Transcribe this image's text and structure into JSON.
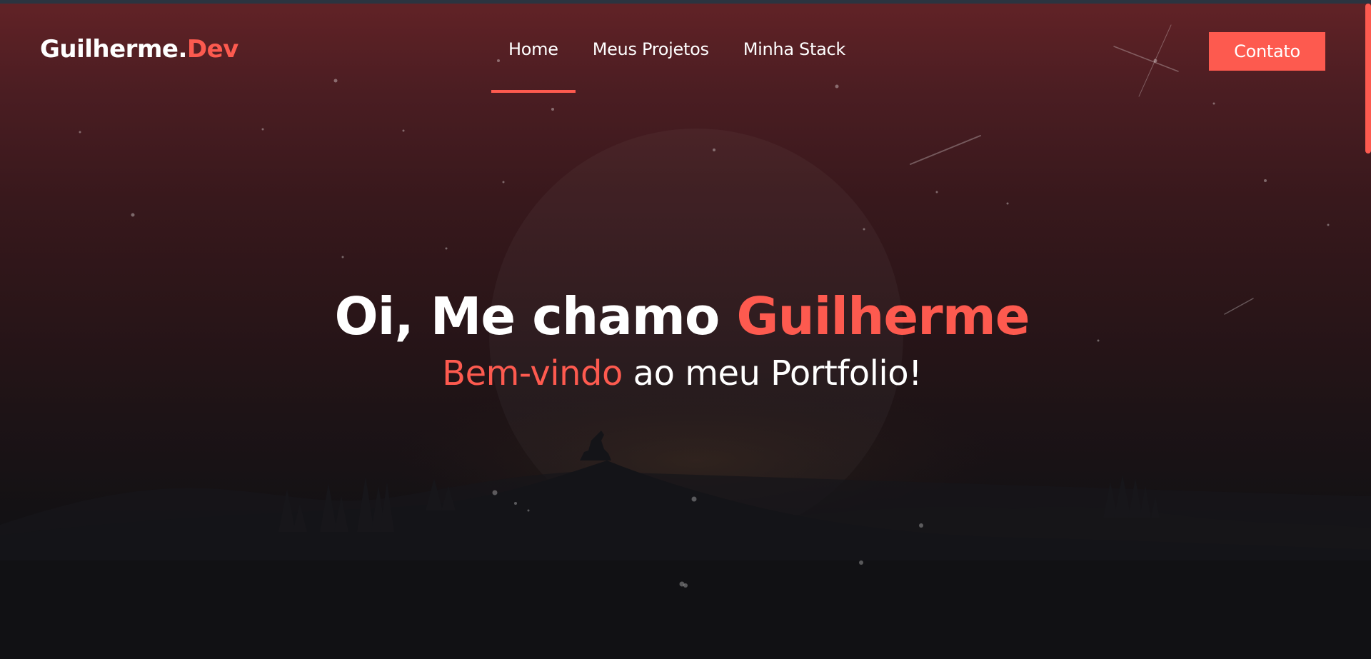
{
  "header": {
    "logo_name": "Guilherme.",
    "logo_accent": "Dev",
    "nav": [
      {
        "label": "Home",
        "active": true
      },
      {
        "label": "Meus Projetos",
        "active": false
      },
      {
        "label": "Minha Stack",
        "active": false
      }
    ],
    "contact_label": "Contato"
  },
  "hero": {
    "greeting": "Oi, Me chamo ",
    "name": "Guilherme",
    "welcome_accent": "Bem-vindo",
    "welcome_rest": " ao meu Portfolio!"
  },
  "colors": {
    "accent": "#fd5a4f",
    "text": "#ffffff",
    "background_top": "#612226",
    "background_bottom": "#0e0f12"
  },
  "icons": {
    "background": "night-landscape-wolf-illustration"
  }
}
